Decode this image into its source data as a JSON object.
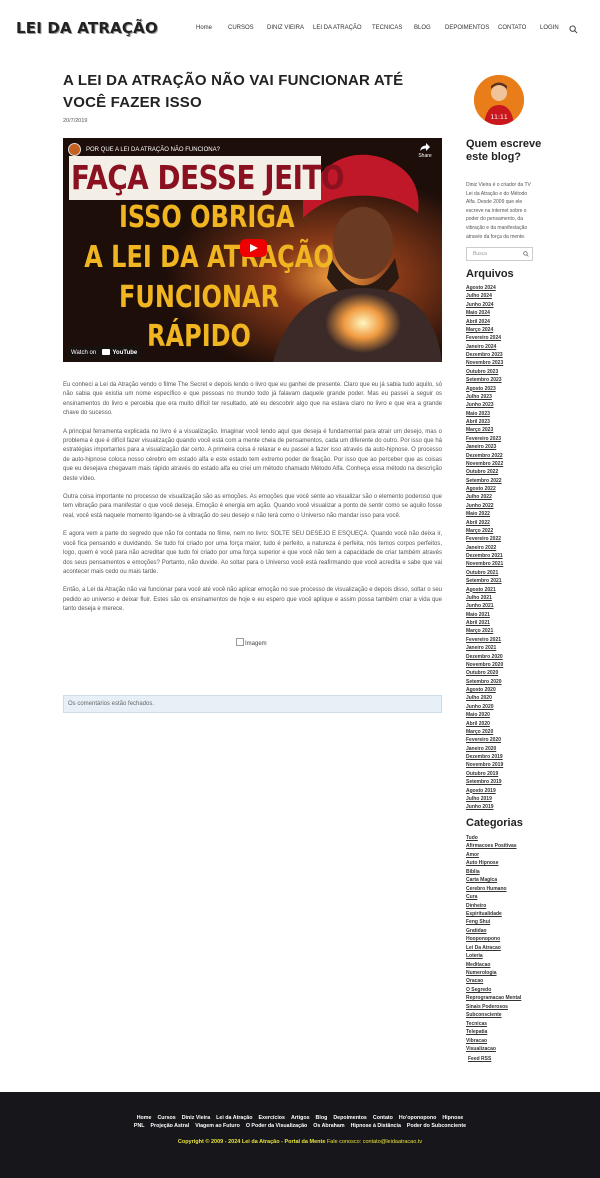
{
  "header": {
    "logo": "LEI DA ATRAÇÃO",
    "nav": [
      "Home",
      "CURSOS",
      "DINIZ VIEIRA",
      "LEI DA ATRAÇÃO",
      "TECNICAS",
      "BLOG",
      "DEPOIMENTOS",
      "CONTATO",
      "LOGIN"
    ]
  },
  "post": {
    "title": "A LEI DA ATRAÇÃO NÃO VAI FUNCIONAR ATÉ VOCÊ FAZER ISSO",
    "date": "20/7/2019",
    "video": {
      "title": "POR QUE A LEI DA ATRAÇÃO NÃO FUNCIONA?",
      "share": "Share",
      "headline": "FAÇA DESSE JEITO",
      "lines": [
        "ISSO OBRIGA",
        "A LEI DA ATRAÇÃO",
        "FUNCIONAR",
        "RÁPIDO"
      ],
      "watch": "Watch on",
      "youtube": "YouTube"
    },
    "paragraphs": [
      "Eu conheci a Lei da Atração vendo o filme The Secret e depois lendo o livro que eu ganhei de presente. Claro que eu já sabia tudo aquilo, só não sabia que existia um nome específico e que pessoas no mundo todo já falavam daquele grande poder. Mas eu passei a seguir os ensinamentos do livro e percebia que era muito difícil ter resultado, até eu descobrir algo que na estava claro no livro e que era a grande chave do sucesso.",
      "A principal ferramenta explicada no livro é a visualização. Imaginar você tendo aquí que deseja é fundamental para atrair um desejo, mas o problema é que é difícil fazer visualização quando você está com a mente cheia de pensamentos, cada um diferente do outro. Por isso que há estratégias importantes para a visualização dar certo. A primeira coisa é relaxar e eu passei a fazer isso através da auto-hipnose. O processo de auto-hipnose coloca nosso cérebro em estado alfa e este estado tem extremo poder de fixação. Por isso que ao perceber que as coisas que eu desejava chegavam mais rápido através do estado alfa eu criei um método chamado Método Alfa. Conheça essa método na descrição deste vídeo.",
      "Outra coisa importante no processo de visualização são as emoções. As emoções que você sente ao visualizar são o elemento poderoso que tem vibração para manifestar o que você deseja. Emoção é energia em ação. Quando você visualizar a ponto de sentir como se aquilo fosse real, você está naquele momento ligando-se à vibração do seu desejo e não terá como o Universo não mandar isso para você.",
      "E agora vem a parte do segredo que não foi contada no filme, nem no livro: SOLTE SEU DESEJO E ESQUEÇA. Quando você não deixa ir, você fica pensando e duvidando. Se tudo foi criado por uma força maior, tudo é perfeito, a natureza é perfeita, nós temos corpos perfeitos, logo, quem é você para não acreditar que tudo foi criado por uma força superior e que você não tem a capacidade de criar também através dos seus pensamentos e emoções? Portanto, não duvide. Ao soltar para o Universo você está reafirmando que você acredita e sabe que vai acontecer mais cedo ou mais tarde.",
      "Então, a Lei da Atração não vai funcionar para você até você não aplicar emoção no sue processo de visualização e depois disso, soltar o seu pedido ao universo e deixar fluir. Estes são os ensinamentos de hoje e eu espero que você aplique e assim possa também criar a vida que tanto deseja e merece."
    ],
    "image_alt": "Imagem",
    "comments_closed": "Os comentários estão fechados."
  },
  "sidebar": {
    "who_title": "Quem escreve este blog?",
    "who_text": "Diniz Vieira é o criador da TV Lei da Atração e do Método Alfa. Desde 2009 que ele escreve na internet sobre o poder do pensamento, da vibração e da manifestação através da força da mente.",
    "search_placeholder": "Busca",
    "archives_title": "Arquivos",
    "archives": [
      "Agosto 2024",
      "Julho 2024",
      "Junho 2024",
      "Maio 2024",
      "Abril 2024",
      "Março 2024",
      "Fevereiro 2024",
      "Janeiro 2024",
      "Dezembro 2023",
      "Novembro 2023",
      "Outubro 2023",
      "Setembro 2023",
      "Agosto 2023",
      "Julho 2023",
      "Junho 2023",
      "Maio 2023",
      "Abril 2023",
      "Março 2023",
      "Fevereiro 2023",
      "Janeiro 2023",
      "Dezembro 2022",
      "Novembro 2022",
      "Outubro 2022",
      "Setembro 2022",
      "Agosto 2022",
      "Julho 2022",
      "Junho 2022",
      "Maio 2022",
      "Abril 2022",
      "Março 2022",
      "Fevereiro 2022",
      "Janeiro 2022",
      "Dezembro 2021",
      "Novembro 2021",
      "Outubro 2021",
      "Setembro 2021",
      "Agosto 2021",
      "Julho 2021",
      "Junho 2021",
      "Maio 2021",
      "Abril 2021",
      "Março 2021",
      "Fevereiro 2021",
      "Janeiro 2021",
      "Dezembro 2020",
      "Novembro 2020",
      "Outubro 2020",
      "Setembro 2020",
      "Agosto 2020",
      "Julho 2020",
      "Junho 2020",
      "Maio 2020",
      "Abril 2020",
      "Março 2020",
      "Fevereiro 2020",
      "Janeiro 2020",
      "Dezembro 2019",
      "Novembro 2019",
      "Outubro 2019",
      "Setembro 2019",
      "Agosto 2019",
      "Julho 2019",
      "Junho 2019"
    ],
    "categories_title": "Categorias",
    "categories": [
      "Tudo",
      "Afirmacoes Positivas",
      "Amor",
      "Auto Hipnose",
      "Biblia",
      "Carta Magica",
      "Cerebro Humano",
      "Cura",
      "Dinheiro",
      "Espiritualidade",
      "Feng Shui",
      "Gratidao",
      "Hooponopono",
      "Lei Da Atracao",
      "Loteria",
      "Meditacao",
      "Numerologia",
      "Oracao",
      "O Segredo",
      "Reprogramacao Mental",
      "Sinais Poderosos",
      "Subconsciente",
      "Tecnicas",
      "Telepatia",
      "Vibracao",
      "Visualizacao"
    ],
    "rss": "Feed RSS"
  },
  "footer": {
    "links_row1": [
      "Home",
      "Cursos",
      "Diniz Vieira",
      "Lei da Atração",
      "Exercícios",
      "Artigos",
      "Blog",
      "Depoimentos",
      "Contato",
      "Ho'oponopono",
      "Hipnose"
    ],
    "links_row2": [
      "PNL",
      "Projeção Astral",
      "Viagem ao Futuro",
      "O Poder da Visualização",
      "Os Abraham",
      "Hipnose à Distância",
      "Poder do Subconciente"
    ],
    "copyright": "Copyright © 2009 - 2024 Lei da Atração - Portal da Mente",
    "contact": "Fale conosco: contato@leidaatracao.tv"
  }
}
